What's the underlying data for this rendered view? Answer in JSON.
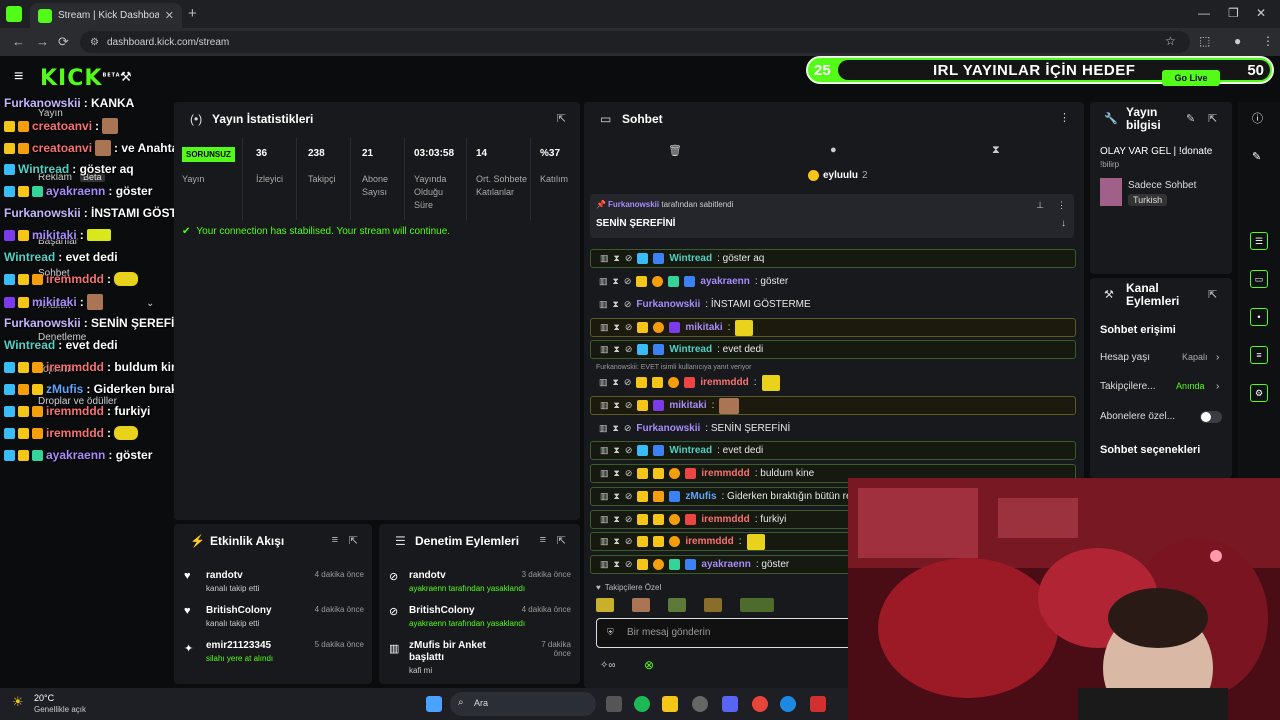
{
  "browser": {
    "tab_title": "Stream | Kick Dashboard",
    "url": "dashboard.kick.com/stream"
  },
  "goal": {
    "current": "25",
    "label": "IRL YAYINLAR İÇİN HEDEF",
    "target": "50",
    "go_live": "Go Live"
  },
  "logo": "KICK",
  "logo_beta": "BETA",
  "sidebar": {
    "nav": [
      "Yayın",
      "Reklam",
      "Beta",
      "Başarılar",
      "Sohbet",
      "Analitik",
      "Denetleme",
      "Topluluk",
      "Droplar ve ödüller"
    ]
  },
  "overlay_chat": [
    {
      "name": "Furkanowskii",
      "text": ": KANKA"
    },
    {
      "name": "creatoanvi",
      "text": ":"
    },
    {
      "name": "creatoanvi",
      "text": ": ve Anahtar"
    },
    {
      "name": "Wintread",
      "text": ": göster aq"
    },
    {
      "name": "ayakraenn",
      "text": ": göster"
    },
    {
      "name": "Furkanowskii",
      "text": ": İNSTAMI GÖSTERME"
    },
    {
      "name": "mikitaki",
      "text": ":"
    },
    {
      "name": "Wintread",
      "text": ": evet dedi"
    },
    {
      "name": "iremmddd",
      "text": ":"
    },
    {
      "name": "mikitaki",
      "text": ":"
    },
    {
      "name": "Furkanowskii",
      "text": ": SENİN ŞEREFİNİ"
    },
    {
      "name": "Wintread",
      "text": ": evet dedi"
    },
    {
      "name": "iremmddd",
      "text": ": buldum kine"
    },
    {
      "name": "zMufis",
      "text": ": Giderken bıraktığın bütün renkler siyah oldu."
    },
    {
      "name": "iremmddd",
      "text": ": furkiyi"
    },
    {
      "name": "iremmddd",
      "text": ":"
    },
    {
      "name": "ayakraenn",
      "text": ": göster"
    }
  ],
  "stats": {
    "title": "Yayın İstatistikleri",
    "offline": "SORUNSUZ",
    "stream_label": "Yayın",
    "items": [
      {
        "value": "36",
        "label": "İzleyici"
      },
      {
        "value": "238",
        "label": "Takipçi"
      },
      {
        "value": "21",
        "label": "Abone Sayısı"
      },
      {
        "value": "03:03:58",
        "label": "Yayında Olduğu Süre"
      },
      {
        "value": "14",
        "label": "Ort. Sohbete Katılanlar"
      },
      {
        "value": "%37",
        "label": "Katılım"
      }
    ],
    "connection": "Your connection has stabilised. Your stream will continue."
  },
  "activity": {
    "title": "Etkinlik Akışı",
    "items": [
      {
        "name": "randotv",
        "sub": "kanalı takip etti",
        "time": "4 dakika önce"
      },
      {
        "name": "BritishColony",
        "sub": "kanalı takip etti",
        "time": "4 dakika önce"
      },
      {
        "name": "emir21123345",
        "sub": "silahı yere at alındı",
        "time": "5 dakika önce"
      }
    ]
  },
  "moderation": {
    "title": "Denetim Eylemleri",
    "items": [
      {
        "name": "randotv",
        "sub": "ayakraenn tarafından yasaklandı",
        "time": "3 dakika önce"
      },
      {
        "name": "BritishColony",
        "sub": "ayakraenn tarafından yasaklandı",
        "time": "4 dakika önce"
      },
      {
        "name": "zMufis bir Anket başlattı",
        "sub": "kafi mi",
        "time": "7 dakika önce"
      }
    ]
  },
  "chat": {
    "title": "Sohbet",
    "top_user": "eyluulu",
    "top_count": "2",
    "pinned_by": "Furkanowskii",
    "pinned_suffix": "tarafından sabitlendi",
    "pinned_msg": "SENİN ŞEREFİNİ",
    "reply_note": "Furkanowskii: EVET isimli kullanıcıya yanıt veriyor",
    "followers_only": "Takipçilere Özel",
    "placeholder": "Bir mesaj gönderin",
    "messages": [
      {
        "name": "Wintread",
        "text": ": göster aq",
        "color": "#4fd1c5"
      },
      {
        "name": "ayakraenn",
        "text": ": göster",
        "color": "#a78bfa"
      },
      {
        "name": "Furkanowskii",
        "text": ": İNSTAMI GÖSTERME",
        "color": "#a78bfa"
      },
      {
        "name": "mikitaki",
        "text": ":",
        "color": "#a78bfa"
      },
      {
        "name": "Wintread",
        "text": ": evet dedi",
        "color": "#4fd1c5"
      },
      {
        "name": "iremmddd",
        "text": ":",
        "color": "#f87171"
      },
      {
        "name": "mikitaki",
        "text": ":",
        "color": "#a78bfa"
      },
      {
        "name": "Furkanowskii",
        "text": ": SENİN ŞEREFİNİ",
        "color": "#a78bfa"
      },
      {
        "name": "Wintread",
        "text": ": evet dedi",
        "color": "#4fd1c5"
      },
      {
        "name": "iremmddd",
        "text": ": buldum kine",
        "color": "#f87171"
      },
      {
        "name": "zMufis",
        "text": ": Giderken bıraktığın bütün re",
        "color": "#60a5fa"
      },
      {
        "name": "iremmddd",
        "text": ": furkiyi",
        "color": "#f87171"
      },
      {
        "name": "iremmddd",
        "text": ":",
        "color": "#f87171"
      },
      {
        "name": "ayakraenn",
        "text": ": göster",
        "color": "#a78bfa"
      }
    ]
  },
  "stream_info": {
    "title": "Yayın bilgisi",
    "stream_title": "OLAY VAR GEL | !donate",
    "extra": "!bilirp",
    "category": "Sadece Sohbet",
    "language": "Turkish"
  },
  "channel_actions": {
    "title": "Kanal Eylemleri",
    "chat_access": "Sohbet erişimi",
    "account_age": "Hesap yaşı",
    "account_age_val": "Kapalı",
    "followers": "Takipçilere...",
    "followers_val": "Anında",
    "subs": "Abonelere özel...",
    "chat_options": "Sohbet seçenekleri"
  },
  "taskbar": {
    "weather_temp": "20°C",
    "weather_desc": "Genellikle açık",
    "search": "Ara"
  }
}
